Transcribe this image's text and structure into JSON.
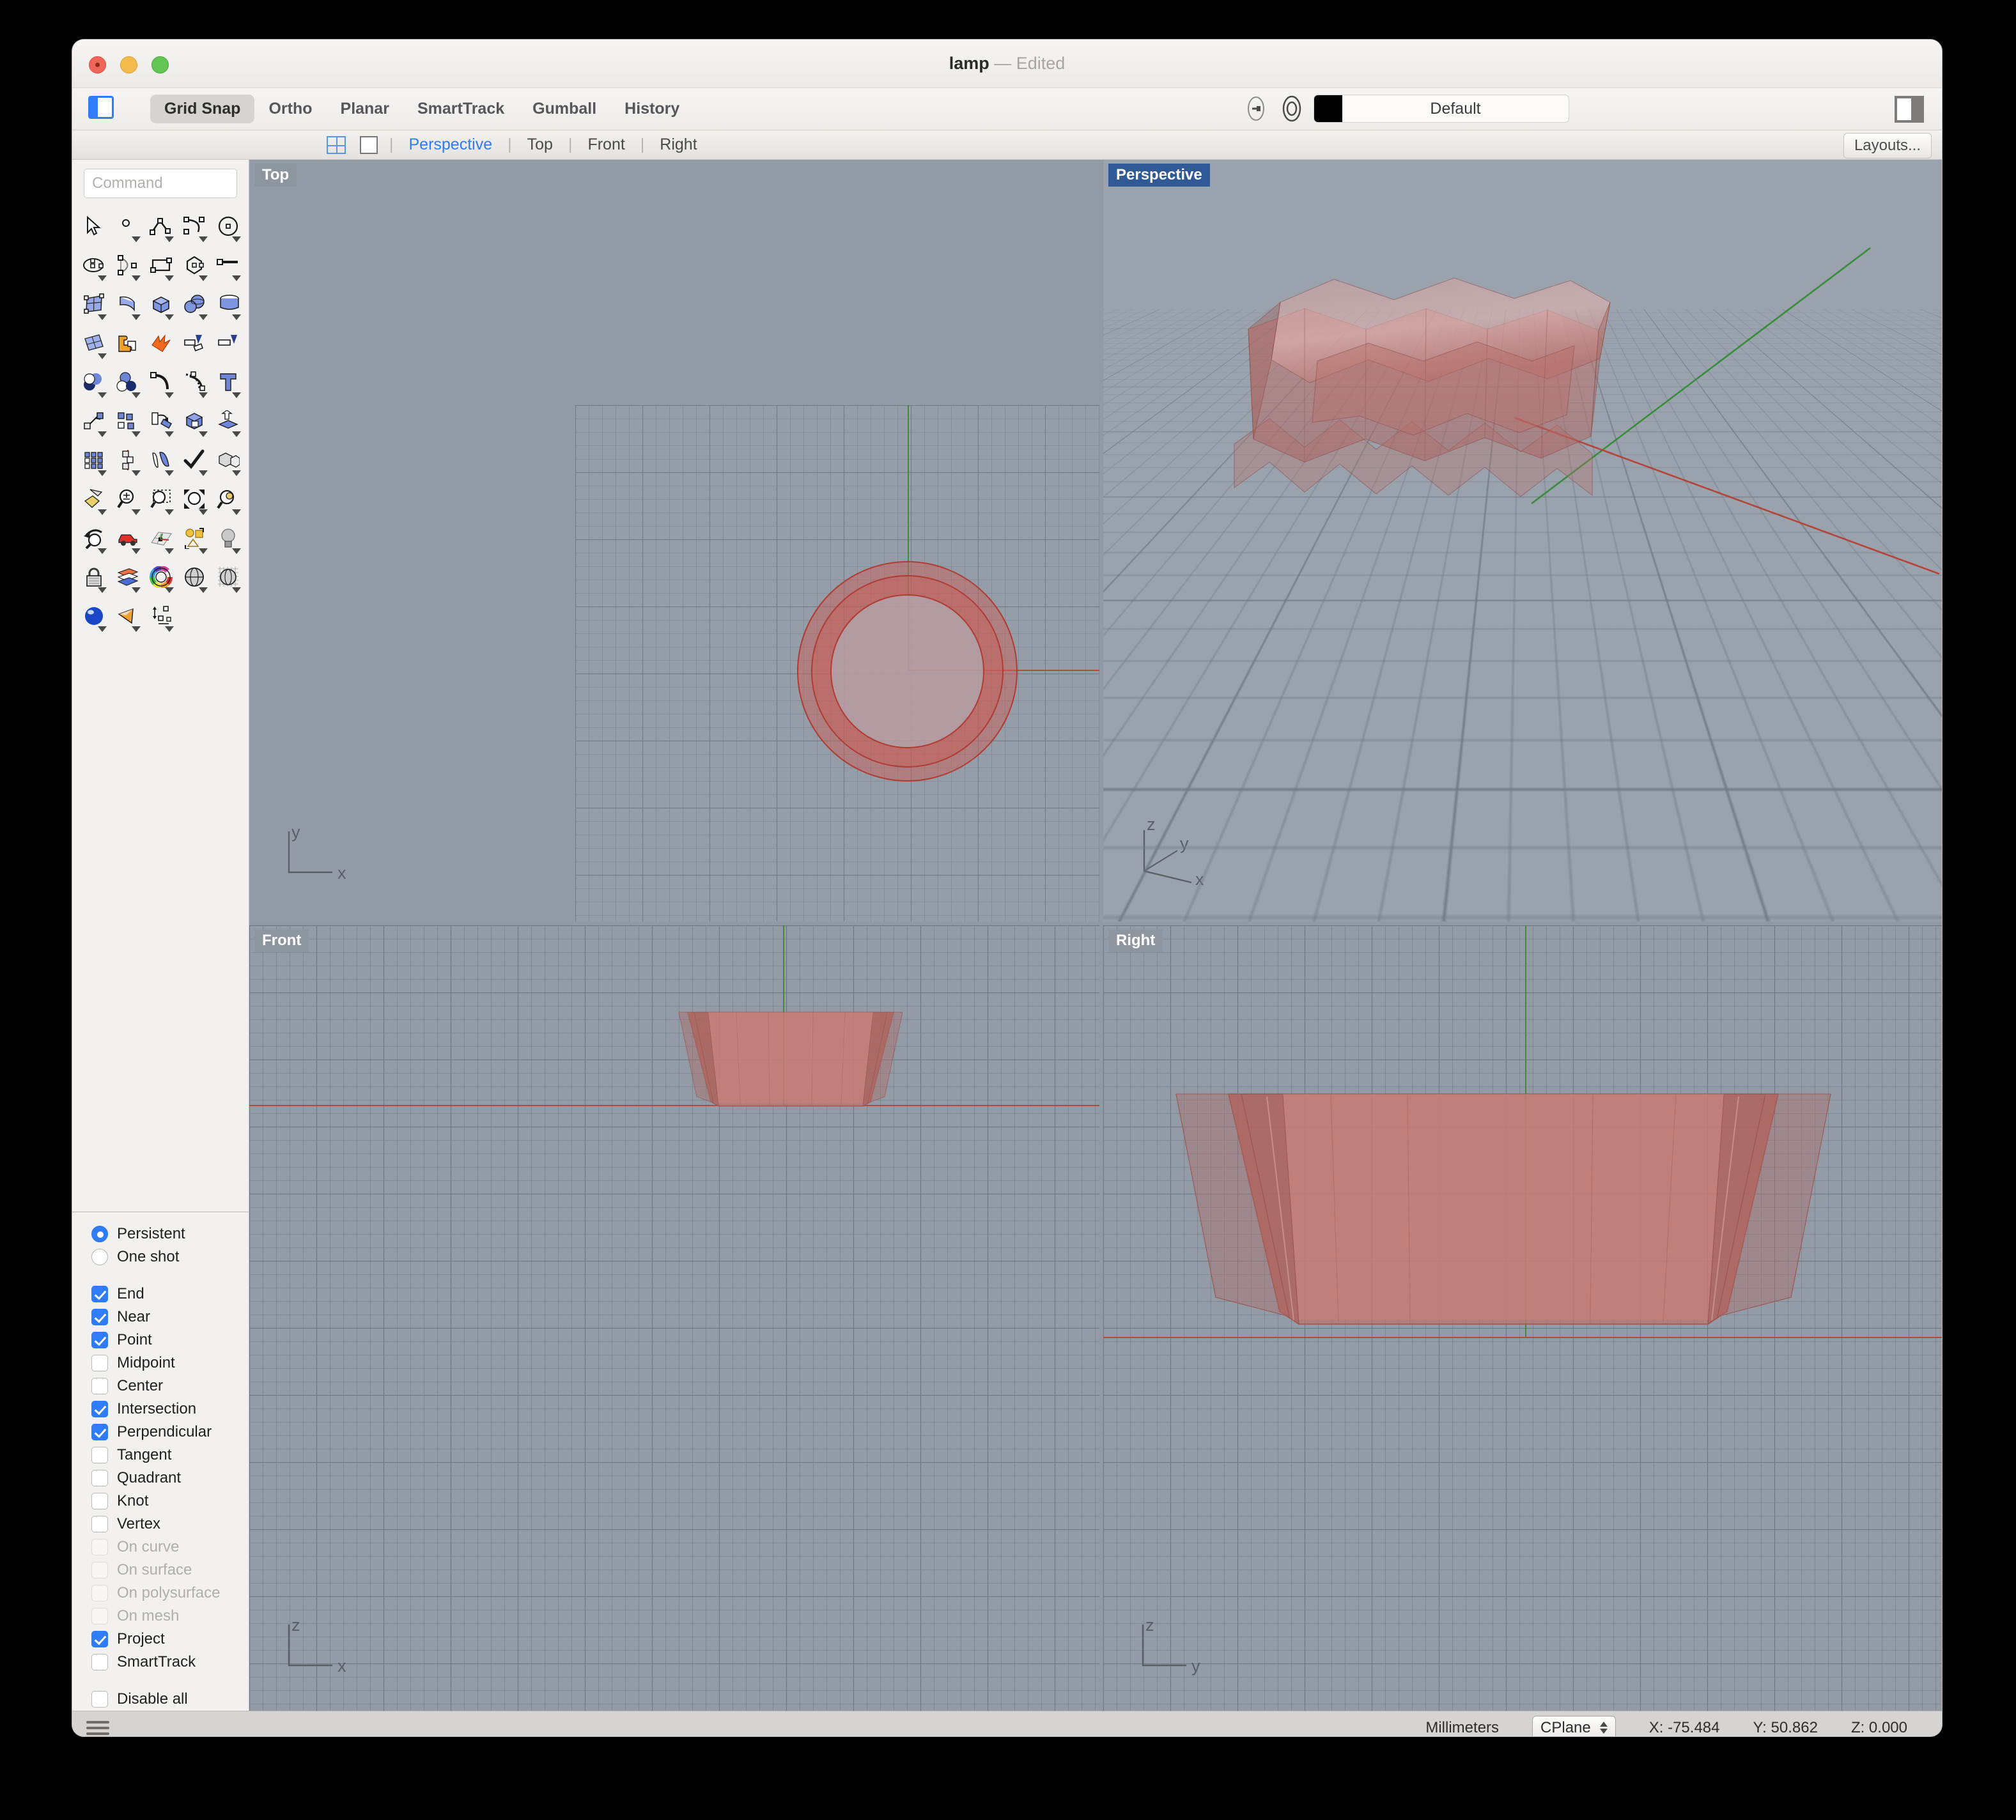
{
  "window": {
    "title": "lamp",
    "title_state": "— Edited"
  },
  "toolbar": {
    "modes": [
      {
        "label": "Grid Snap",
        "active": true
      },
      {
        "label": "Ortho",
        "active": false
      },
      {
        "label": "Planar",
        "active": false
      },
      {
        "label": "SmartTrack",
        "active": false
      },
      {
        "label": "Gumball",
        "active": false
      },
      {
        "label": "History",
        "active": false
      }
    ],
    "layer": {
      "name": "Default",
      "color": "#000000"
    },
    "sidebar_toggle_icon": "sidebar-toggle-icon",
    "right_panel_toggle_icon": "right-panel-toggle-icon"
  },
  "viewport_tabs": {
    "four_view_icon": "four-view-layout-icon",
    "single_view_icon": "single-view-layout-icon",
    "tabs": [
      {
        "label": "Perspective",
        "active": true
      },
      {
        "label": "Top",
        "active": false
      },
      {
        "label": "Front",
        "active": false
      },
      {
        "label": "Right",
        "active": false
      }
    ],
    "layouts_label": "Layouts..."
  },
  "sidebar": {
    "command": {
      "placeholder": "Command",
      "value": ""
    },
    "snap": {
      "mode_options": [
        {
          "label": "Persistent",
          "selected": true
        },
        {
          "label": "One shot",
          "selected": false
        }
      ],
      "items": [
        {
          "label": "End",
          "checked": true,
          "enabled": true
        },
        {
          "label": "Near",
          "checked": true,
          "enabled": true
        },
        {
          "label": "Point",
          "checked": true,
          "enabled": true
        },
        {
          "label": "Midpoint",
          "checked": false,
          "enabled": true
        },
        {
          "label": "Center",
          "checked": false,
          "enabled": true
        },
        {
          "label": "Intersection",
          "checked": true,
          "enabled": true
        },
        {
          "label": "Perpendicular",
          "checked": true,
          "enabled": true
        },
        {
          "label": "Tangent",
          "checked": false,
          "enabled": true
        },
        {
          "label": "Quadrant",
          "checked": false,
          "enabled": true
        },
        {
          "label": "Knot",
          "checked": false,
          "enabled": true
        },
        {
          "label": "Vertex",
          "checked": false,
          "enabled": true
        },
        {
          "label": "On curve",
          "checked": false,
          "enabled": false
        },
        {
          "label": "On surface",
          "checked": false,
          "enabled": false
        },
        {
          "label": "On polysurface",
          "checked": false,
          "enabled": false
        },
        {
          "label": "On mesh",
          "checked": false,
          "enabled": false
        },
        {
          "label": "Project",
          "checked": true,
          "enabled": true
        },
        {
          "label": "SmartTrack",
          "checked": false,
          "enabled": true
        }
      ],
      "disable_all": {
        "label": "Disable all",
        "checked": false
      }
    }
  },
  "viewports": {
    "top": {
      "label": "Top",
      "active": false,
      "axes": [
        "y",
        "x"
      ]
    },
    "perspective": {
      "label": "Perspective",
      "active": true,
      "axes": [
        "z",
        "y",
        "x"
      ]
    },
    "front": {
      "label": "Front",
      "active": false,
      "axes": [
        "z",
        "x"
      ]
    },
    "right": {
      "label": "Right",
      "active": false,
      "axes": [
        "z",
        "y"
      ]
    }
  },
  "model": {
    "object": "lamp shade",
    "shading": "translucent red faceted polysurface",
    "color": "#c85f58"
  },
  "statusbar": {
    "menu_icon": "hamburger-menu-icon",
    "units": "Millimeters",
    "cplane": "CPlane",
    "x": "X: -75.484",
    "y": "Y: 50.862",
    "z": "Z: 0.000"
  }
}
